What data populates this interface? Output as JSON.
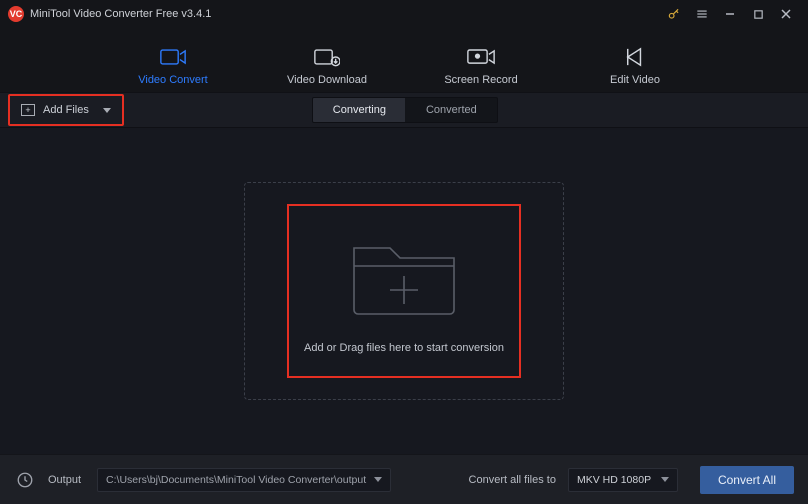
{
  "titlebar": {
    "app_title": "MiniTool Video Converter Free v3.4.1"
  },
  "main_tabs": {
    "video_convert": "Video Convert",
    "video_download": "Video Download",
    "screen_record": "Screen Record",
    "edit_video": "Edit Video"
  },
  "subbar": {
    "add_files": "Add Files",
    "converting": "Converting",
    "converted": "Converted"
  },
  "dropzone": {
    "message": "Add or Drag files here to start conversion"
  },
  "footer": {
    "output_label": "Output",
    "output_path": "C:\\Users\\bj\\Documents\\MiniTool Video Converter\\output",
    "convert_files_label": "Convert all files to",
    "format_selected": "MKV HD 1080P",
    "convert_all": "Convert All"
  }
}
